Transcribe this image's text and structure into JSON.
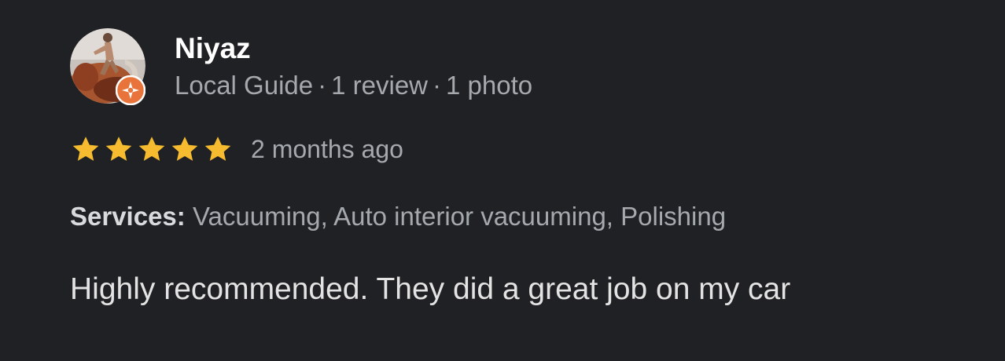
{
  "review": {
    "author": {
      "name": "Niyaz",
      "avatar_icon": "user-avatar-photo",
      "badge_icon": "local-guide-badge-icon"
    },
    "meta": {
      "role": "Local Guide",
      "reviews": "1 review",
      "photos": "1 photo",
      "separator": "·"
    },
    "rating": {
      "stars": 5,
      "max": 5,
      "star_color": "#f6bb2e"
    },
    "time": "2 months ago",
    "services": {
      "label": "Services:",
      "value": "Vacuuming, Auto interior vacuuming, Polishing"
    },
    "text": "Highly recommended. They did a great job on my car"
  },
  "colors": {
    "background": "#202124",
    "name": "#ffffff",
    "secondary_text": "#a5a8ad",
    "body_text": "#e3e3e3",
    "badge": "#e8743b"
  }
}
